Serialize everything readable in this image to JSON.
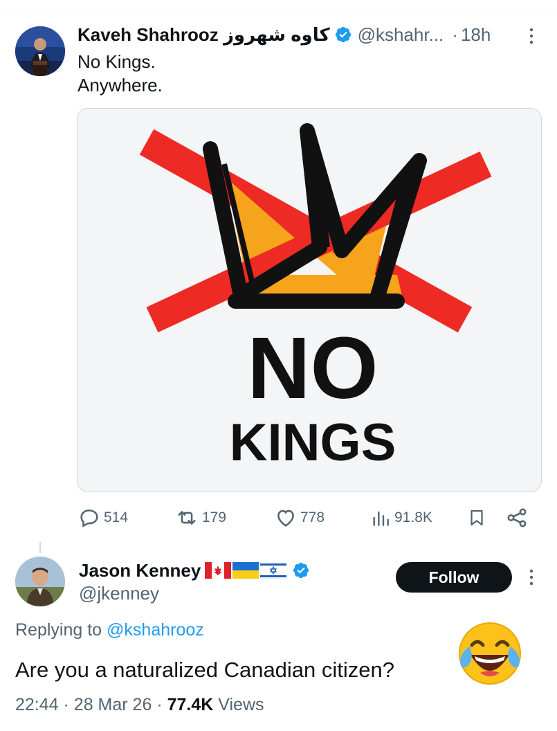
{
  "tweet": {
    "display_name": "Kaveh Shahrooz کاوه شهروز",
    "handle": "@kshahr...",
    "separator": "·",
    "time": "18h",
    "text_line1": "No Kings.",
    "text_line2": "Anywhere.",
    "image": {
      "word1": "NO",
      "word2": "KINGS"
    },
    "actions": {
      "replies": "514",
      "reposts": "179",
      "likes": "778",
      "views": "91.8K"
    }
  },
  "reply": {
    "display_name": "Jason Kenney",
    "flags": [
      "canada-flag",
      "ukraine-flag",
      "israel-flag"
    ],
    "handle": "@jkenney",
    "follow_label": "Follow",
    "replying_prefix": "Replying to",
    "replying_mention": "@kshahrooz",
    "text": "Are you a naturalized Canadian citizen?",
    "emoji": "face-with-tears-of-joy",
    "time": "22:44",
    "date": "28 Mar 26",
    "views_count": "77.4K",
    "views_label": "Views"
  },
  "colors": {
    "verified": "#1d9bf0",
    "link": "#1d9bf0",
    "secondary_text": "#536471",
    "primary_text": "#0f1419",
    "follow_button": "#0f1419",
    "red_x": "#ee2a24",
    "crown_fill": "#f6a41c"
  }
}
